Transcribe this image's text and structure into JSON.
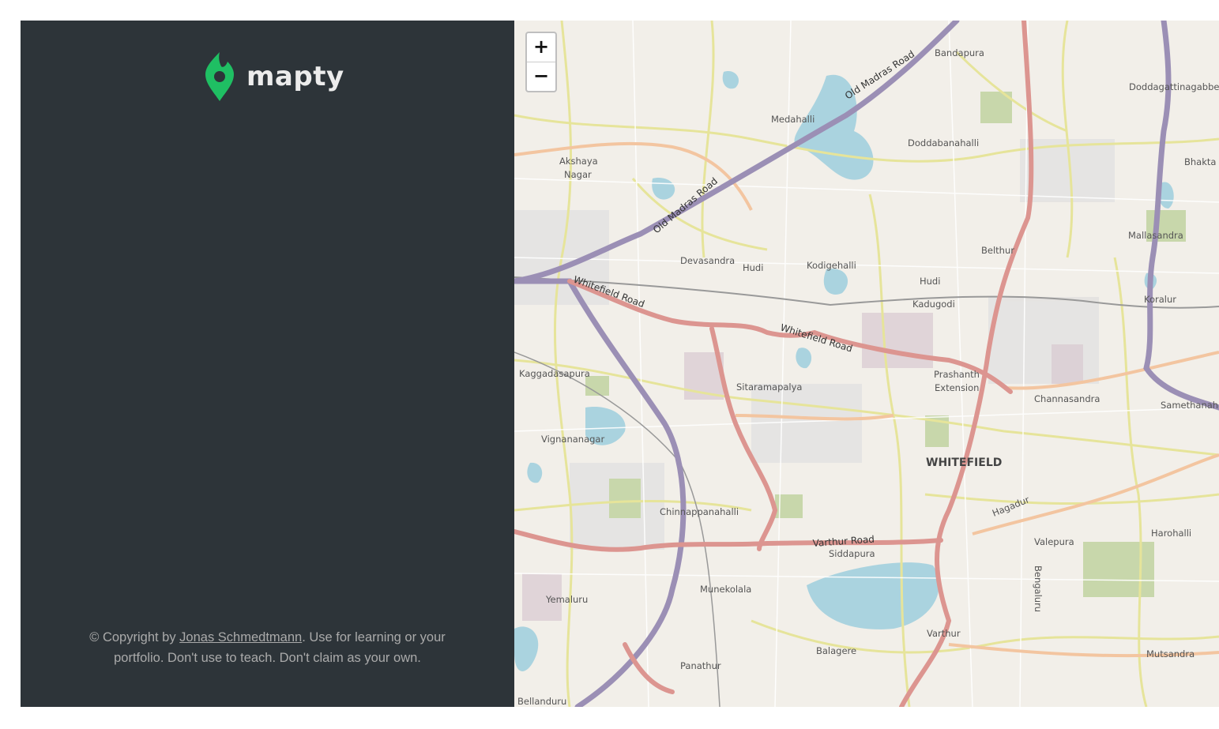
{
  "brand": {
    "name": "mapty",
    "accent": "#1fbf63"
  },
  "footer": {
    "prefix": "© Copyright by ",
    "author_link": "Jonas Schmedtmann",
    "suffix": ". Use for learning or your portfolio. Don't use to teach. Don't claim as your own."
  },
  "map": {
    "zoom_in": "+",
    "zoom_out": "−",
    "places": [
      "Bandapura",
      "Doddagattinagabbe",
      "Medahalli",
      "Doddabanahalli",
      "Akshaya",
      "Nagar",
      "Bhakta",
      "Mallasandra",
      "Devasandra",
      "Hudi",
      "Kodigehalli",
      "Belthur",
      "Hudi",
      "Kadugodi",
      "Koralur",
      "Kaggadasapura",
      "Prashanth",
      "Extension",
      "Sitaramapalya",
      "Channasandra",
      "Samethanahalli",
      "Vignananagar",
      "WHITEFIELD",
      "Chinnappanahalli",
      "Hagadur",
      "Harohalli",
      "Valepura",
      "Siddapura",
      "Munekolala",
      "Yemaluru",
      "Varthur",
      "Balagere",
      "Panathur",
      "Mutsandra",
      "Bellanduru",
      "Bengaluru"
    ],
    "roads": [
      "Old Madras Road",
      "Old Madras Road",
      "Whitefield Road",
      "Whitefield Road",
      "Varthur Road"
    ]
  }
}
